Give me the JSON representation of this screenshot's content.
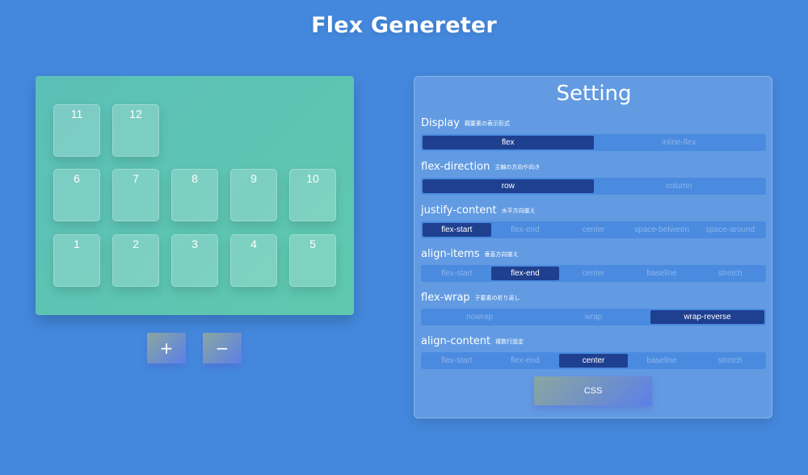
{
  "app": {
    "title": "Flex Genereter"
  },
  "stage": {
    "items": [
      "11",
      "12",
      "6",
      "7",
      "8",
      "9",
      "10",
      "1",
      "2",
      "3",
      "4",
      "5"
    ]
  },
  "controls": {
    "add_label": "+",
    "remove_label": "−"
  },
  "panel": {
    "title": "Setting",
    "settings": [
      {
        "label": "Display",
        "sub": "親要素の表示形式",
        "options": [
          "flex",
          "inline-flex"
        ],
        "selected": "flex"
      },
      {
        "label": "flex-direction",
        "sub": "主軸の方向や向き",
        "options": [
          "row",
          "column"
        ],
        "selected": "row"
      },
      {
        "label": "justify-content",
        "sub": "水平方向揃え",
        "options": [
          "flex-start",
          "flex-end",
          "center",
          "space-between",
          "space-around"
        ],
        "selected": "flex-start"
      },
      {
        "label": "align-items",
        "sub": "垂直方向揃え",
        "options": [
          "flex-start",
          "flex-end",
          "center",
          "baseline",
          "stretch"
        ],
        "selected": "flex-end"
      },
      {
        "label": "flex-wrap",
        "sub": "子要素の折り返し",
        "options": [
          "nowrap",
          "wrap",
          "wrap-reverse"
        ],
        "selected": "wrap-reverse"
      },
      {
        "label": "align-content",
        "sub": "複数行設定",
        "options": [
          "flex-start",
          "flex-end",
          "center",
          "baseline",
          "stretch"
        ],
        "selected": "center"
      }
    ],
    "css_button_label": "CSS"
  }
}
